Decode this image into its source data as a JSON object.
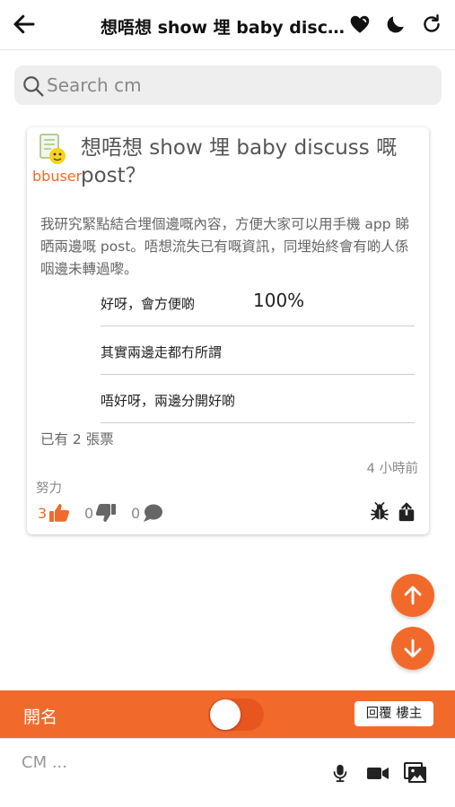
{
  "header": {
    "title": "想唔想 show 埋 baby discuss 嘅 post？",
    "icons": [
      "back-arrow-icon",
      "heart-icon",
      "moon-icon",
      "refresh-icon"
    ]
  },
  "search": {
    "placeholder": "Search cm"
  },
  "post": {
    "username": "bbuser",
    "title": "想唔想 show 埋 baby discuss 嘅 post？",
    "body": "我研究緊點結合埋個邊嘅內容，方便大家可以用手機 app 睇晒兩邊嘅 post。唔想流失已有嘅資訊，同埋始終會有啲人係咽邊未轉過嚟。",
    "poll": [
      {
        "label": "好呀，會方便啲",
        "percent": "100%"
      },
      {
        "label": "其實兩邊走都冇所謂",
        "percent": ""
      },
      {
        "label": "唔好呀，兩邊分開好啲",
        "percent": ""
      }
    ],
    "vote_count": "已有 2 張票",
    "time": "4 小時前",
    "effort": "努力",
    "likes": "3",
    "dislikes": "0",
    "comments": "0"
  },
  "reply_bar": {
    "anonymous_label": "開名",
    "anonymous_enabled": false,
    "reply_op_label": "回覆  樓主"
  },
  "composer": {
    "placeholder": "CM ..."
  },
  "colors": {
    "accent": "#f26a2b",
    "accent_dark": "#e8561f",
    "background": "#ffffff"
  }
}
